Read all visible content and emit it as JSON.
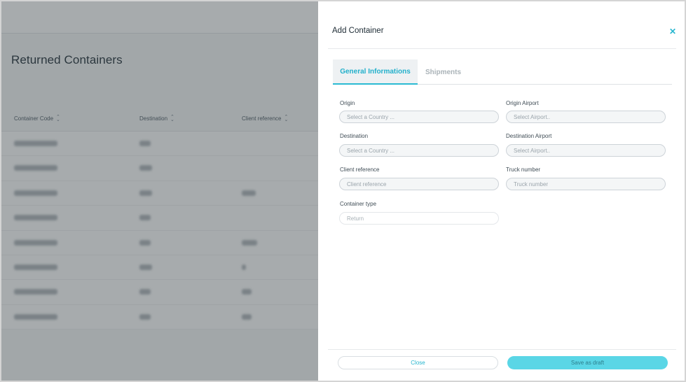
{
  "background_page": {
    "title": "Returned Containers",
    "columns": [
      "Container Code",
      "Destination",
      "Client reference"
    ],
    "rows_blurred": 8
  },
  "drawer": {
    "title": "Add Container",
    "close_icon": "close-icon",
    "tabs": [
      {
        "label": "General Informations",
        "active": true
      },
      {
        "label": "Shipments",
        "active": false
      }
    ],
    "fields": {
      "origin": {
        "label": "Origin",
        "placeholder": "Select a Country ..."
      },
      "origin_airport": {
        "label": "Origin Airport",
        "placeholder": "Select Airport.."
      },
      "destination": {
        "label": "Destination",
        "placeholder": "Select a Country ..."
      },
      "destination_airport": {
        "label": "Destination Airport",
        "placeholder": "Select Airport.."
      },
      "client_reference": {
        "label": "Client reference",
        "placeholder": "Client reference"
      },
      "truck_number": {
        "label": "Truck number",
        "placeholder": "Truck number"
      },
      "container_type": {
        "label": "Container type",
        "value": "Return"
      }
    },
    "footer": {
      "close_label": "Close",
      "save_label": "Save as draft"
    }
  },
  "colors": {
    "accent": "#27b6cf",
    "save_button": "#5ad6e6",
    "overlay": "rgba(60,68,74,0.45)"
  }
}
